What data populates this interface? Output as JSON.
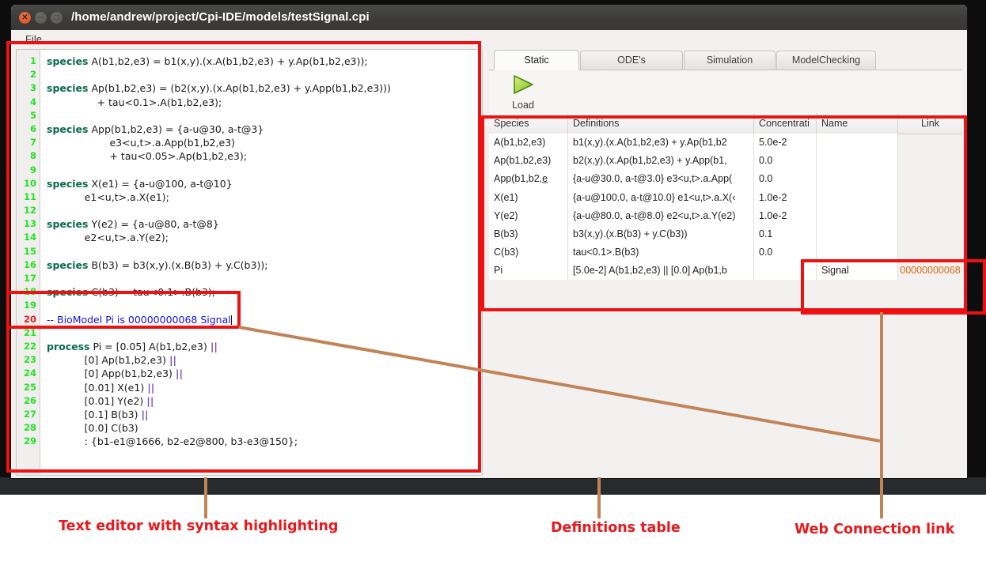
{
  "window": {
    "title": "/home/andrew/project/Cpi-IDE/models/testSignal.cpi",
    "menu": {
      "file": "File"
    },
    "controls": {
      "close": "close-button",
      "minimize": "minimize-button",
      "maximize": "maximize-button"
    }
  },
  "editor": {
    "line_numbers": [
      "1",
      "2",
      "3",
      "4",
      "5",
      "6",
      "7",
      "8",
      "9",
      "10",
      "11",
      "12",
      "13",
      "14",
      "15",
      "16",
      "17",
      "18",
      "19",
      "20",
      "21",
      "22",
      "23",
      "24",
      "25",
      "26",
      "27",
      "28",
      "29"
    ],
    "modified_line": "20",
    "lines": [
      "species A(b1,b2,e3) = b1(x,y).(x.A(b1,b2,e3) + y.Ap(b1,b2,e3));",
      "",
      "species Ap(b1,b2,e3) = (b2(x,y).(x.Ap(b1,b2,e3) + y.App(b1,b2,e3)))",
      "                + tau<0.1>.A(b1,b2,e3);",
      "",
      "species App(b1,b2,e3) = {a-u@30, a-t@3}",
      "                    e3<u,t>.a.App(b1,b2,e3)",
      "                    + tau<0.05>.Ap(b1,b2,e3);",
      "",
      "species X(e1) = {a-u@100, a-t@10}",
      "            e1<u,t>.a.X(e1);",
      "",
      "species Y(e2) = {a-u@80, a-t@8}",
      "            e2<u,t>.a.Y(e2);",
      "",
      "species B(b3) = b3(x,y).(x.B(b3) + y.C(b3));",
      "",
      "species C(b3) = tau<0.1>.B(b3);",
      "",
      "-- BioModel Pi is 00000000068 Signal",
      "",
      "process Pi = [0.05] A(b1,b2,e3) ||",
      "            [0] Ap(b1,b2,e3) ||",
      "            [0] App(b1,b2,e3) ||",
      "            [0.01] X(e1) ||",
      "            [0.01] Y(e2) ||",
      "            [0.1] B(b3) ||",
      "            [0.0] C(b3)",
      "            : {b1-e1@1666, b2-e2@800, b3-e3@150};"
    ],
    "comment_line": "-- BioModel Pi is 00000000068 Signal"
  },
  "tabs": [
    {
      "label": "Static",
      "active": true
    },
    {
      "label": "ODE's",
      "active": false
    },
    {
      "label": "Simulation",
      "active": false
    },
    {
      "label": "ModelChecking",
      "active": false
    }
  ],
  "toolbar": {
    "load_label": "Load",
    "load_icon": "play-triangle-icon"
  },
  "table": {
    "headers": [
      "Species",
      "Definitions",
      "Concentrati",
      "Name",
      "Link"
    ],
    "rows": [
      {
        "species": "A(b1,b2,e3)",
        "definition": "b1(x,y).(x.A(b1,b2,e3) + y.Ap(b1,b2",
        "concentration": "5.0e-2",
        "name": "",
        "link": ""
      },
      {
        "species": "Ap(b1,b2,e3)",
        "definition": "b2(x,y).(x.Ap(b1,b2,e3) + y.App(b1,",
        "concentration": "0.0",
        "name": "",
        "link": ""
      },
      {
        "species": "App(b1,b2,e̲",
        "definition": "{a-u@30.0, a-t@3.0} e3<u,t>.a.App(",
        "concentration": "0.0",
        "name": "",
        "link": ""
      },
      {
        "species": "X(e1)",
        "definition": "{a-u@100.0, a-t@10.0} e1<u,t>.a.X(‹",
        "concentration": "1.0e-2",
        "name": "",
        "link": ""
      },
      {
        "species": "Y(e2)",
        "definition": "{a-u@80.0, a-t@8.0} e2<u,t>.a.Y(e2)",
        "concentration": "1.0e-2",
        "name": "",
        "link": ""
      },
      {
        "species": "B(b3)",
        "definition": "b3(x,y).(x.B(b3) + y.C(b3))",
        "concentration": "0.1",
        "name": "",
        "link": ""
      },
      {
        "species": "C(b3)",
        "definition": "tau<0.1>.B(b3)",
        "concentration": "0.0",
        "name": "",
        "link": ""
      },
      {
        "species": "Pi",
        "definition": "[5.0e-2] A(b1,b2,e3) || [0.0] Ap(b1,b",
        "concentration": "",
        "name": "Signal",
        "link": "00000000068"
      }
    ]
  },
  "annotations": {
    "editor_caption": "Text editor with syntax highlighting",
    "definitions_caption": "Definitions table",
    "web_caption": "Web Connection link"
  },
  "colors": {
    "annotation_red": "#ee1111",
    "caption_red": "#e8191c",
    "leader_brown": "#c08457",
    "link_orange": "#e06a16",
    "keyword_green": "#0b6b4f",
    "comment_blue": "#1313e0",
    "linenum_green": "#22e322",
    "linenum_modified_red": "#e02020"
  }
}
